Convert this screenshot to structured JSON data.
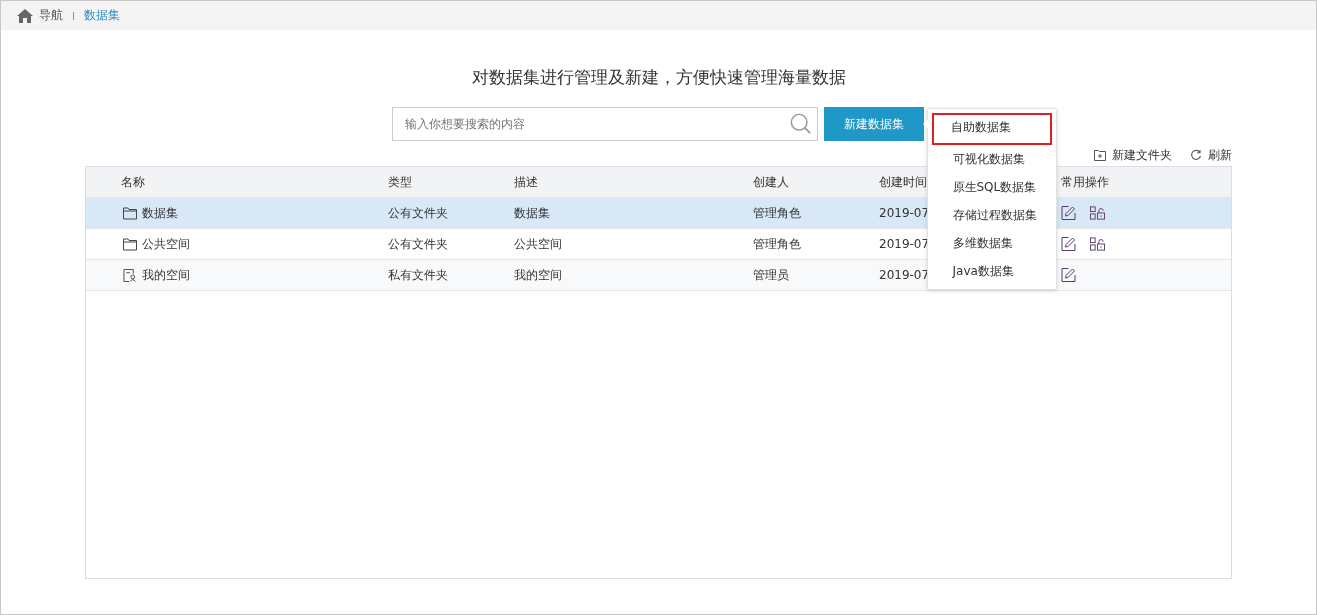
{
  "breadcrumb": {
    "home": "导航",
    "current": "数据集"
  },
  "heading": "对数据集进行管理及新建，方便快速管理海量数据",
  "search": {
    "placeholder": "输入你想要搜索的内容"
  },
  "new_button": "新建数据集",
  "toolbar": [
    {
      "kind": "new-folder",
      "label": "新建文件夹"
    },
    {
      "kind": "refresh",
      "label": "刷新"
    }
  ],
  "table": {
    "columns": [
      "名称",
      "类型",
      "描述",
      "创建人",
      "创建时间",
      "常用操作"
    ],
    "rows": [
      {
        "kind": "folder",
        "name": "数据集",
        "type": "公有文件夹",
        "description": "数据集",
        "creator": "管理角色",
        "created": "2019-07",
        "actions": [
          {
            "kind": "edit"
          },
          {
            "kind": "permission"
          }
        ],
        "selected": true
      },
      {
        "kind": "folder",
        "name": "公共空间",
        "type": "公有文件夹",
        "description": "公共空间",
        "creator": "管理角色",
        "created": "2019-07",
        "actions": [
          {
            "kind": "edit"
          },
          {
            "kind": "permission"
          }
        ],
        "selected": false
      },
      {
        "kind": "private",
        "name": "我的空间",
        "type": "私有文件夹",
        "description": "我的空间",
        "creator": "管理员",
        "created": "2019-07",
        "actions": [
          {
            "kind": "edit"
          }
        ],
        "selected": false
      }
    ]
  },
  "dropdown": [
    {
      "label": "自助数据集",
      "selected": true
    },
    {
      "label": "可视化数据集",
      "selected": false
    },
    {
      "label": "原生SQL数据集",
      "selected": false
    },
    {
      "label": "存储过程数据集",
      "selected": false
    },
    {
      "label": "多维数据集",
      "selected": false
    },
    {
      "label": "Java数据集",
      "selected": false
    }
  ]
}
